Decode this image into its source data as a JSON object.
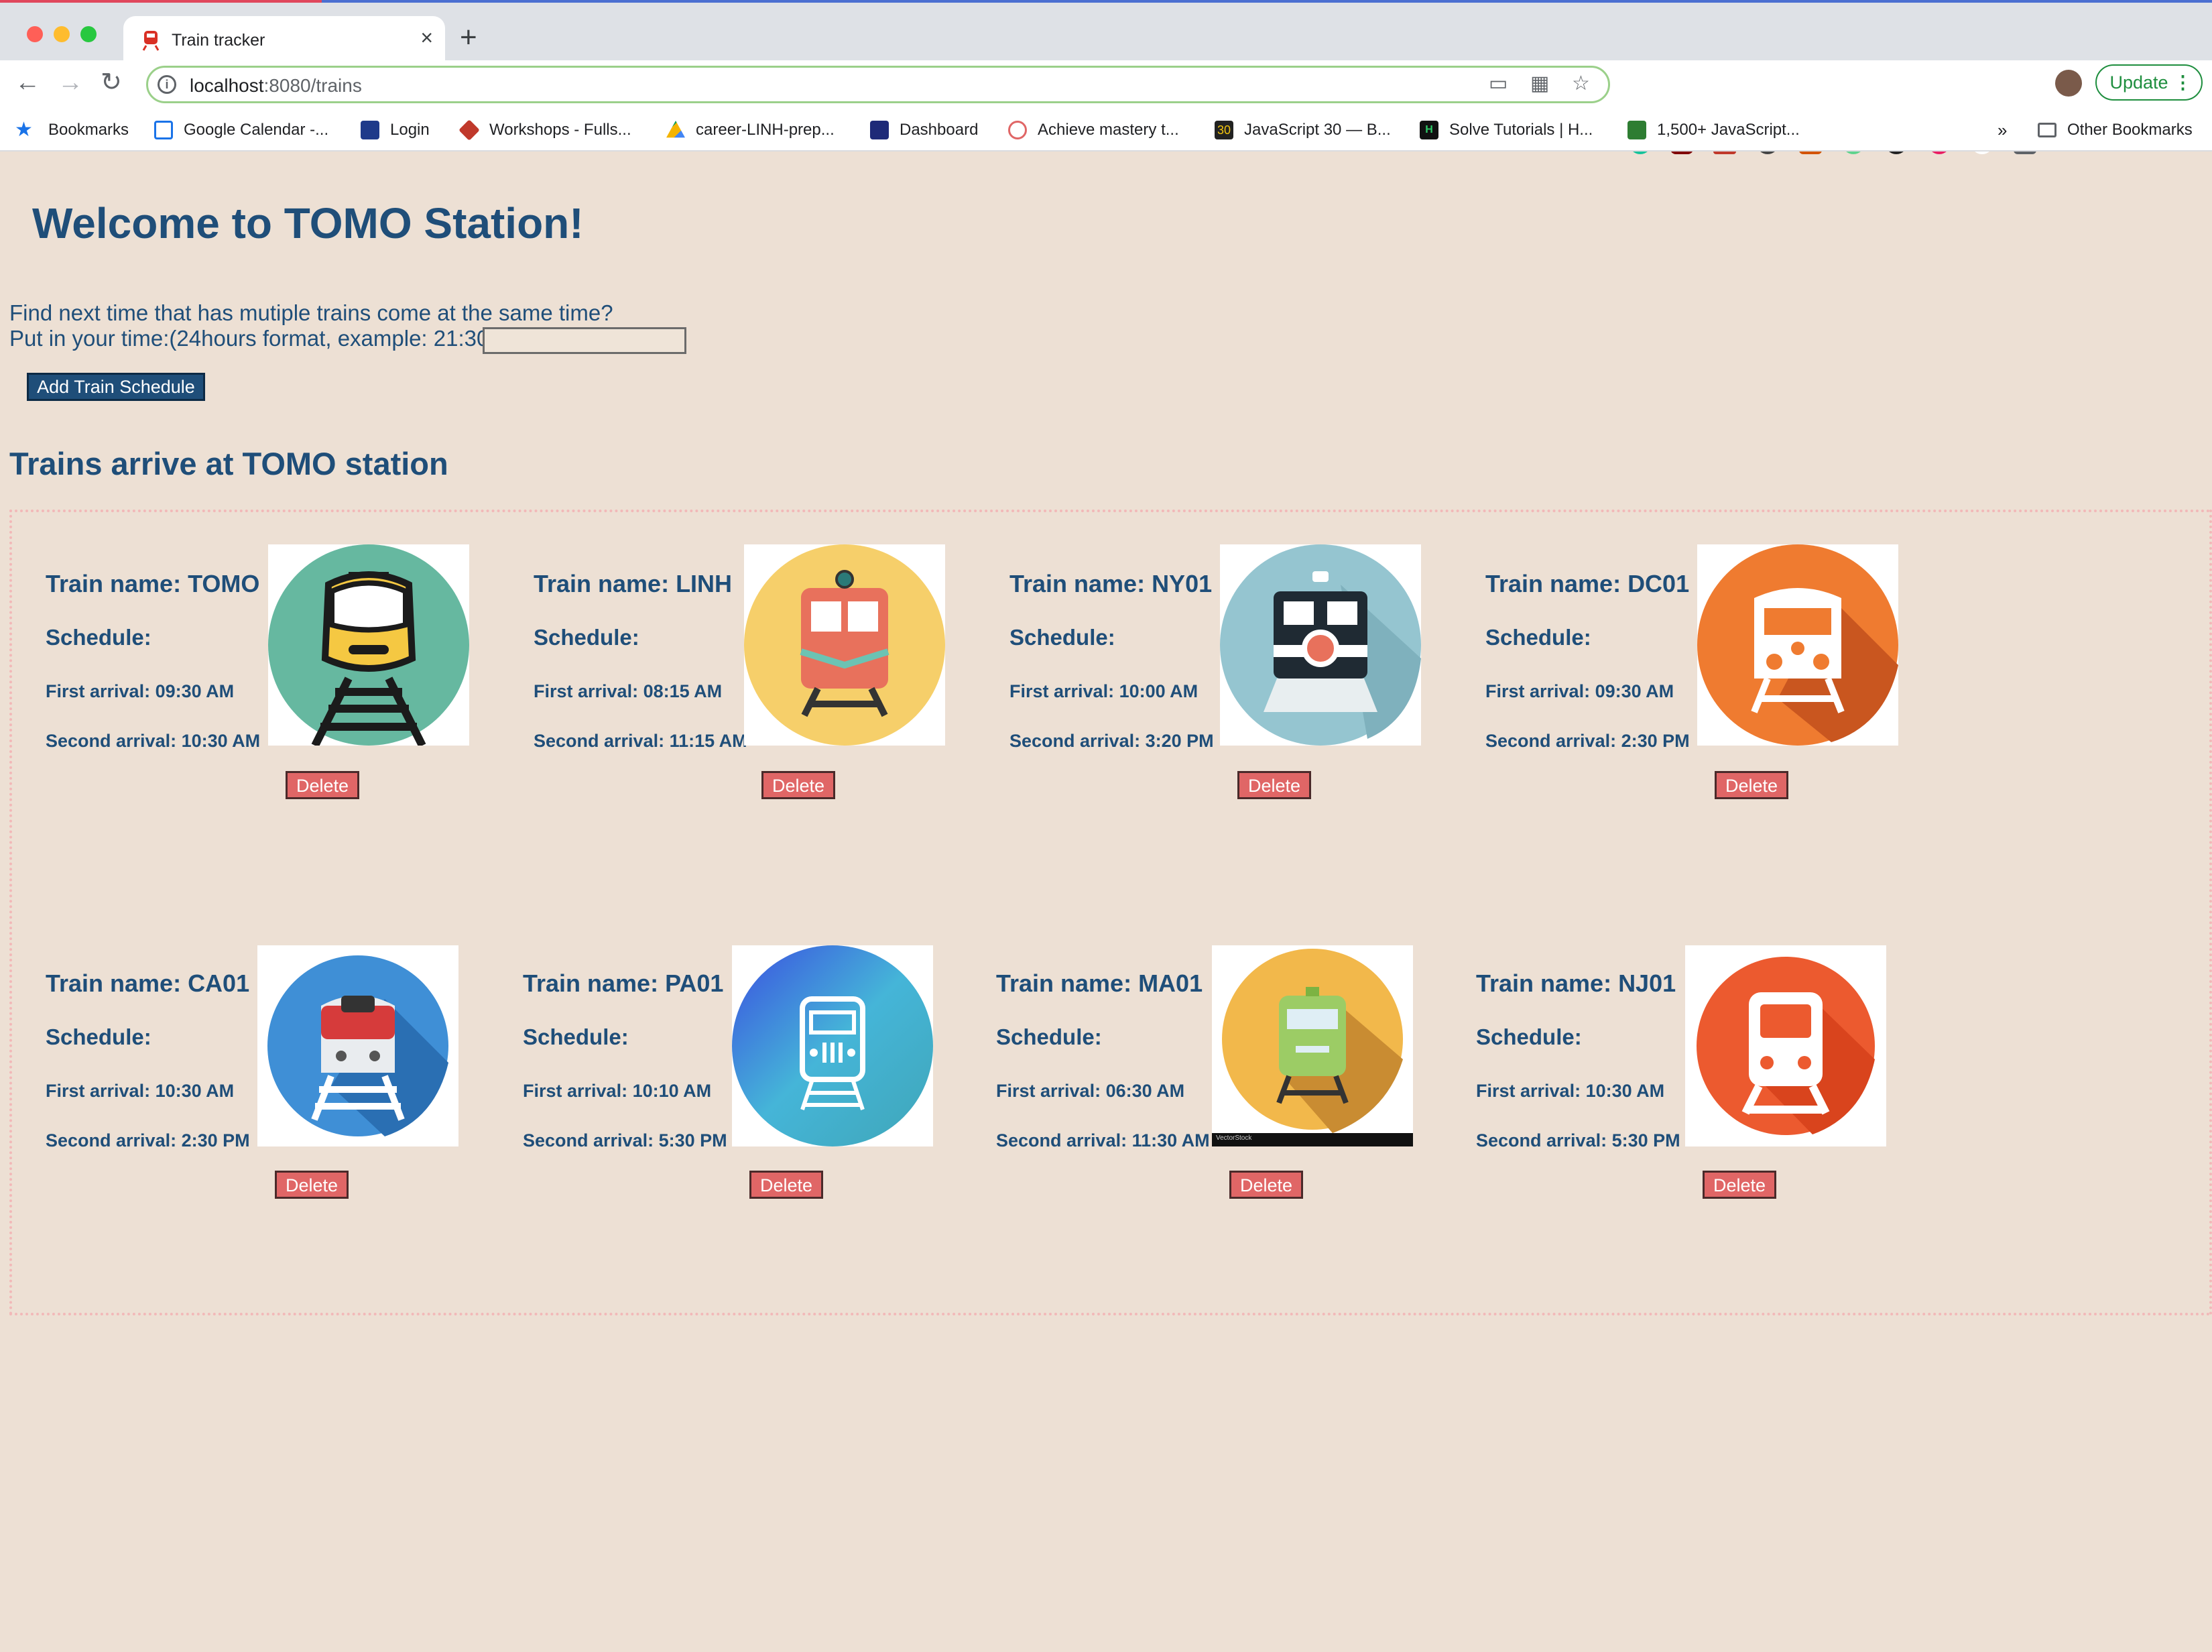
{
  "browser": {
    "tab_title": "Train tracker",
    "url_host": "localhost",
    "url_rest": ":8080/trains",
    "update_label": "Update",
    "bookmarks": [
      "Bookmarks",
      "Google Calendar -...",
      "Login",
      "Workshops - Fulls...",
      "career-LINH-prep...",
      "Dashboard",
      "Achieve mastery t...",
      "JavaScript 30 — B...",
      "Solve Tutorials | H...",
      "1,500+ JavaScript..."
    ],
    "more_label": "»",
    "other_bookmarks": "Other Bookmarks",
    "colors": {
      "tab_strip": "#dee1e6",
      "omnibox_border": "#9bd08a",
      "update_green": "#1e8e3e"
    }
  },
  "page": {
    "title": "Welcome to TOMO Station!",
    "prompt_line1": "Find next time that has mutiple trains come at the same time?",
    "prompt_line2": "Put in your time:(24hours format, example: 21:30)",
    "time_input_value": "",
    "add_button": "Add Train Schedule",
    "section_title": "Trains arrive at TOMO station",
    "schedule_label": "Schedule:",
    "delete_label": "Delete",
    "colors": {
      "background": "#ede0d4",
      "text": "#1f4e79",
      "delete_button": "#e06666"
    }
  },
  "trains": [
    {
      "name": "Train name: TOMO",
      "first": "First arrival: 09:30 AM",
      "second": "Second arrival: 10:30 AM",
      "icon": "green-train-track-icon"
    },
    {
      "name": "Train name: LINH",
      "first": "First arrival: 08:15 AM",
      "second": "Second arrival: 11:15 AM",
      "icon": "yellow-train-icon"
    },
    {
      "name": "Train name: NY01",
      "first": "First arrival: 10:00 AM",
      "second": "Second arrival: 3:20 PM",
      "icon": "locomotive-icon"
    },
    {
      "name": "Train name: DC01",
      "first": "First arrival: 09:30 AM",
      "second": "Second arrival: 2:30 PM",
      "icon": "orange-train-icon"
    },
    {
      "name": "Train name: CA01",
      "first": "First arrival: 10:30 AM",
      "second": "Second arrival: 2:30 PM",
      "icon": "blue-train-icon"
    },
    {
      "name": "Train name: PA01",
      "first": "First arrival: 10:10 AM",
      "second": "Second arrival: 5:30 PM",
      "icon": "gradient-train-icon"
    },
    {
      "name": "Train name: MA01",
      "first": "First arrival: 06:30 AM",
      "second": "Second arrival: 11:30 AM",
      "icon": "green-tram-icon",
      "watermark": "VectorStock"
    },
    {
      "name": "Train name: NJ01",
      "first": "First arrival: 10:30 AM",
      "second": "Second arrival: 5:30 PM",
      "icon": "red-train-icon"
    }
  ]
}
